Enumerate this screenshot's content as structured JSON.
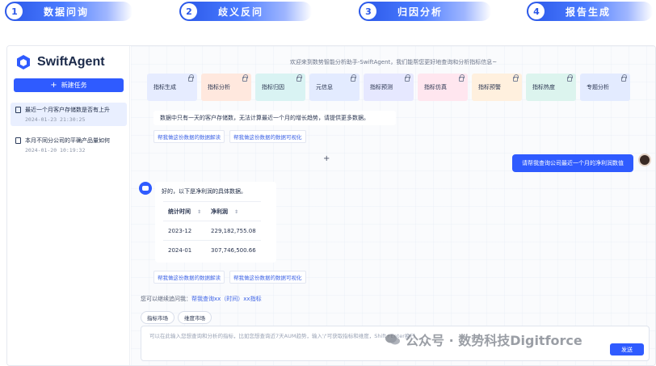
{
  "steps": [
    {
      "num": "1",
      "label": "数据问询"
    },
    {
      "num": "2",
      "label": "歧义反问"
    },
    {
      "num": "3",
      "label": "归因分析"
    },
    {
      "num": "4",
      "label": "报告生成"
    }
  ],
  "app": {
    "name": "SwiftAgent",
    "new_task_label": "新建任务",
    "history": [
      {
        "title": "最近一个月客户存储数是否有上升",
        "date": "2024-01-23 21:30:25"
      },
      {
        "title": "本月不同分公司的平确产品量如何",
        "date": "2024-01-20 10:19:32"
      }
    ]
  },
  "main": {
    "welcome": "欢迎来到数势智能分析助手-SwiftAgent，我们能帮您更好地查询和分析指标信息~",
    "cards": [
      {
        "label": "指标生成",
        "color": "#e6ecff"
      },
      {
        "label": "指标分析",
        "color": "#ffe8de"
      },
      {
        "label": "指标归因",
        "color": "#d9f3f3"
      },
      {
        "label": "元信息",
        "color": "#e3ebff"
      },
      {
        "label": "指标预测",
        "color": "#e6e8ff"
      },
      {
        "label": "指标仿真",
        "color": "#ffe6ef"
      },
      {
        "label": "指标预警",
        "color": "#fff0de"
      },
      {
        "label": "指标热度",
        "color": "#dcf4ee"
      },
      {
        "label": "专题分析",
        "color": "#e3ebff"
      }
    ],
    "notice": "数据中只有一天的客户存储数，无法计算最近一个月的增长趋势，请提供更多数据。",
    "links_1": [
      "帮我做这份数据的数据解读",
      "帮我做这份数据的数据可视化"
    ],
    "user_message": "请帮我查询公司最近一个月的净利润数值",
    "answer_caption": "好的，以下是净利润的具体数据。",
    "table": {
      "headers": [
        "统计时间",
        "净利润"
      ],
      "sort_glyph": "⇕",
      "rows": [
        [
          "2023-12",
          "229,182,755.08"
        ],
        [
          "2024-01",
          "307,746,500.66"
        ]
      ]
    },
    "links_2": [
      "帮我做这份数据的数据解读",
      "帮我做这份数据的数据可视化"
    ],
    "follow_prefix": "您可以继续追问我：",
    "follow_suggestion": "帮我查询xx（时间）xx指标",
    "chips": [
      "指标市场",
      "维度市场"
    ],
    "input_placeholder": "可以在此输入您想查询和分析的指标，比如您想查询近7天AUM趋势，输入'/'可获取指标和维度，Shift+Enter换行",
    "send_label": "发送"
  },
  "watermark": "公众号 · 数势科技Digitforce"
}
